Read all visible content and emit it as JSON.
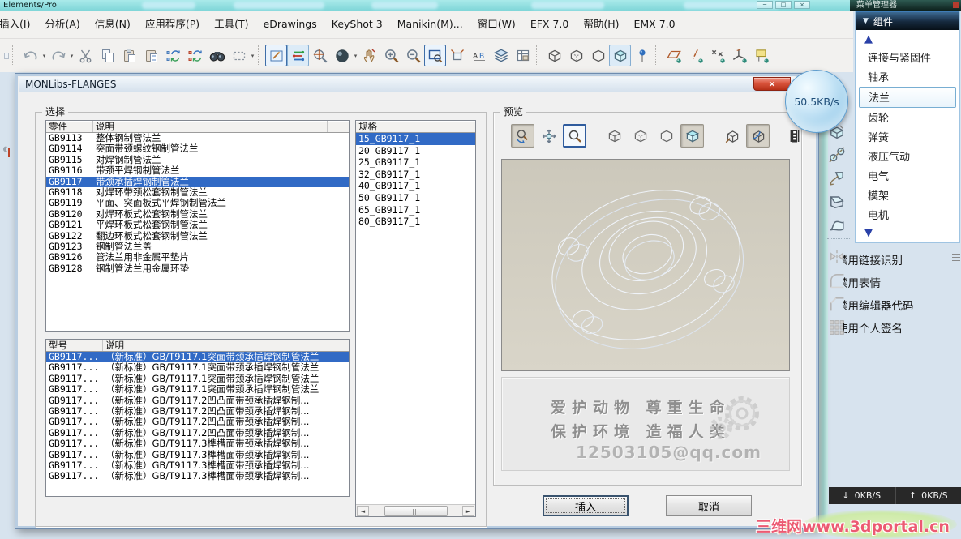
{
  "window": {
    "title": "Elements/Pro",
    "controls": {
      "minimize": "─",
      "maximize": "□",
      "close": "×"
    },
    "speed_bubble": "50.5KB/s"
  },
  "menubar": {
    "items": [
      "插入(I)",
      "分析(A)",
      "信息(N)",
      "应用程序(P)",
      "工具(T)",
      "eDrawings",
      "KeyShot 3",
      "Manikin(M)...",
      "窗口(W)",
      "EFX 7.0",
      "帮助(H)",
      "EMX 7.0"
    ]
  },
  "toolbar": {
    "icons": [
      "doc-partial",
      "undo",
      "undo-dropdown",
      "redo",
      "redo-dropdown",
      "cut",
      "copy",
      "paste",
      "paste-special",
      "regenerate",
      "regenerate-auto",
      "find",
      "select-box",
      "select-dropdown",
      "sketch-display",
      "datum-display",
      "zoom-center",
      "shaded-style",
      "shaded-dropdown",
      "drag-hand",
      "zoom-in",
      "zoom-out",
      "zoom-window",
      "refit",
      "annotations",
      "layers",
      "view-manager",
      "view-wireframe",
      "view-hidden-line",
      "view-no-hidden",
      "view-shaded",
      "spin-center-pin",
      "datum-plane-toggle",
      "datum-axis-toggle",
      "datum-point-toggle",
      "datum-csys-toggle",
      "annotation-toggle"
    ]
  },
  "dialog": {
    "title": "MONLibs-FLANGES",
    "select": {
      "label": "选择",
      "parts": {
        "headers": [
          "零件",
          "说明"
        ],
        "selected_index": 4,
        "rows": [
          {
            "code": "GB9113",
            "desc": "整体钢制管法兰"
          },
          {
            "code": "GB9114",
            "desc": "突面带颈螺纹钢制管法兰"
          },
          {
            "code": "GB9115",
            "desc": "对焊钢制管法兰"
          },
          {
            "code": "GB9116",
            "desc": "带颈平焊钢制管法兰"
          },
          {
            "code": "GB9117",
            "desc": "带颈承插焊钢制管法兰"
          },
          {
            "code": "GB9118",
            "desc": "对焊环带颈松套钢制管法兰"
          },
          {
            "code": "GB9119",
            "desc": "平面、突面板式平焊钢制管法兰"
          },
          {
            "code": "GB9120",
            "desc": "对焊环板式松套钢制管法兰"
          },
          {
            "code": "GB9121",
            "desc": "平焊环板式松套钢制管法兰"
          },
          {
            "code": "GB9122",
            "desc": "翻边环板式松套钢制管法兰"
          },
          {
            "code": "GB9123",
            "desc": "钢制管法兰盖"
          },
          {
            "code": "GB9126",
            "desc": "管法兰用非金属平垫片"
          },
          {
            "code": "GB9128",
            "desc": "钢制管法兰用金属环垫"
          }
        ]
      },
      "specs": {
        "header": "规格",
        "selected_index": 0,
        "items": [
          "15_GB9117_1",
          "20_GB9117_1",
          "25_GB9117_1",
          "32_GB9117_1",
          "40_GB9117_1",
          "50_GB9117_1",
          "65_GB9117_1",
          "80_GB9117_1"
        ]
      },
      "models": {
        "headers": [
          "型号",
          "说明"
        ],
        "selected_index": 0,
        "rows": [
          {
            "code": "GB9117...",
            "desc": "（新标准）GB/T9117.1突面带颈承插焊钢制管法兰"
          },
          {
            "code": "GB9117...",
            "desc": "（新标准）GB/T9117.1突面带颈承插焊钢制管法兰"
          },
          {
            "code": "GB9117...",
            "desc": "（新标准）GB/T9117.1突面带颈承插焊钢制管法兰"
          },
          {
            "code": "GB9117...",
            "desc": "（新标准）GB/T9117.1突面带颈承插焊钢制管法兰"
          },
          {
            "code": "GB9117...",
            "desc": "（新标准）GB/T9117.2凹凸面带颈承插焊钢制..."
          },
          {
            "code": "GB9117...",
            "desc": "（新标准）GB/T9117.2凹凸面带颈承插焊钢制..."
          },
          {
            "code": "GB9117...",
            "desc": "（新标准）GB/T9117.2凹凸面带颈承插焊钢制..."
          },
          {
            "code": "GB9117...",
            "desc": "（新标准）GB/T9117.2凹凸面带颈承插焊钢制..."
          },
          {
            "code": "GB9117...",
            "desc": "（新标准）GB/T9117.3榫槽面带颈承插焊钢制..."
          },
          {
            "code": "GB9117...",
            "desc": "（新标准）GB/T9117.3榫槽面带颈承插焊钢制..."
          },
          {
            "code": "GB9117...",
            "desc": "（新标准）GB/T9117.3榫槽面带颈承插焊钢制..."
          },
          {
            "code": "GB9117...",
            "desc": "（新标准）GB/T9117.3榫槽面带颈承插焊钢制..."
          }
        ]
      }
    },
    "preview": {
      "label": "预览",
      "toolbar_icons": [
        "preview-spin",
        "preview-pan",
        "preview-zoom",
        "preview-wireframe",
        "preview-hidden-line",
        "preview-no-hidden",
        "preview-shaded",
        "preview-iso",
        "preview-iso-clip",
        "preview-animate"
      ],
      "watermark_line1": "爱护动物 尊重生命",
      "watermark_line2": "保护环境 造福人类",
      "watermark_email": "12503105@qq.com"
    },
    "buttons": {
      "insert": "插入",
      "cancel": "取消"
    }
  },
  "right_rail": {
    "icons": [
      "extrude",
      "revolve",
      "sweep",
      "blend",
      "boundary",
      "mirror",
      "round",
      "chamfer",
      "pattern"
    ]
  },
  "menu_manager": {
    "title": "菜单管理器",
    "panel_header": "组件",
    "up_arrow": "▲",
    "down_arrow": "▼",
    "selected": "法兰",
    "items": [
      "连接与紧固件",
      "轴承",
      "法兰",
      "齿轮",
      "弹簧",
      "液压气动",
      "电气",
      "模架",
      "电机"
    ]
  },
  "background_page": {
    "links": [
      "禁用链接识别",
      "禁用表情",
      "禁用编辑器代码",
      "使用个人签名"
    ]
  },
  "status": {
    "down_label": "0KB/S",
    "up_label": "0KB/S",
    "down_icon": "↓",
    "up_icon": "↑"
  },
  "site_watermark": "三维网www.3dportal.cn"
}
